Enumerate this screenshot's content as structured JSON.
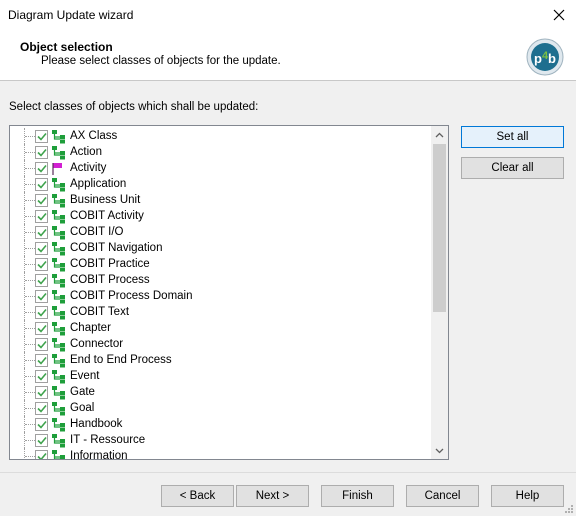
{
  "window": {
    "title": "Diagram Update wizard"
  },
  "header": {
    "title": "Object selection",
    "subtitle": "Please select classes of objects for the update.",
    "logo_text": "p4b"
  },
  "section_label": "Select classes of objects which shall be updated:",
  "items": [
    {
      "label": "AX Class",
      "icon": "green-hierarchy-icon",
      "checked": true
    },
    {
      "label": "Action",
      "icon": "green-hierarchy-icon",
      "checked": true
    },
    {
      "label": "Activity",
      "icon": "magenta-flag-icon",
      "checked": true
    },
    {
      "label": "Application",
      "icon": "green-hierarchy-icon",
      "checked": true
    },
    {
      "label": "Business Unit",
      "icon": "green-hierarchy-icon",
      "checked": true
    },
    {
      "label": "COBIT Activity",
      "icon": "green-hierarchy-icon",
      "checked": true
    },
    {
      "label": "COBIT I/O",
      "icon": "green-hierarchy-icon",
      "checked": true
    },
    {
      "label": "COBIT Navigation",
      "icon": "green-hierarchy-icon",
      "checked": true
    },
    {
      "label": "COBIT Practice",
      "icon": "green-hierarchy-icon",
      "checked": true
    },
    {
      "label": "COBIT Process",
      "icon": "green-hierarchy-icon",
      "checked": true
    },
    {
      "label": "COBIT Process Domain",
      "icon": "green-hierarchy-icon",
      "checked": true
    },
    {
      "label": "COBIT Text",
      "icon": "green-hierarchy-icon",
      "checked": true
    },
    {
      "label": "Chapter",
      "icon": "green-hierarchy-icon",
      "checked": true
    },
    {
      "label": "Connector",
      "icon": "green-hierarchy-icon",
      "checked": true
    },
    {
      "label": "End to End Process",
      "icon": "green-hierarchy-icon",
      "checked": true
    },
    {
      "label": "Event",
      "icon": "green-hierarchy-icon",
      "checked": true
    },
    {
      "label": "Gate",
      "icon": "green-hierarchy-icon",
      "checked": true
    },
    {
      "label": "Goal",
      "icon": "green-hierarchy-icon",
      "checked": true
    },
    {
      "label": "Handbook",
      "icon": "green-hierarchy-icon",
      "checked": true
    },
    {
      "label": "IT - Ressource",
      "icon": "green-hierarchy-icon",
      "checked": true
    },
    {
      "label": "Information",
      "icon": "green-hierarchy-icon",
      "checked": true
    }
  ],
  "side_buttons": {
    "set_all": "Set all",
    "clear_all": "Clear all"
  },
  "footer": {
    "back": "< Back",
    "next": "Next >",
    "finish": "Finish",
    "cancel": "Cancel",
    "help": "Help"
  },
  "colors": {
    "accent": "#0078d7",
    "icon_green": "#1e9e3a",
    "icon_magenta": "#d21fd2",
    "check_green": "#3fa34d"
  }
}
